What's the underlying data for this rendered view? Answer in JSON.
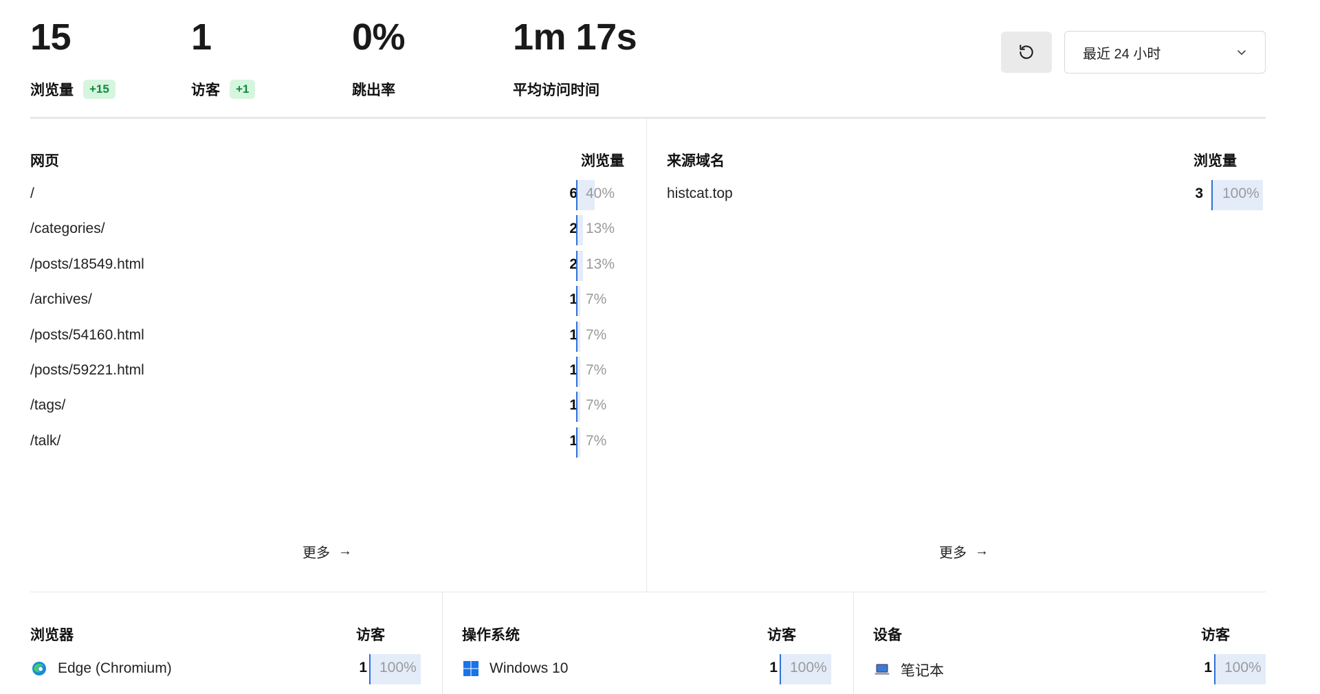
{
  "metrics": [
    {
      "value": "15",
      "label": "浏览量",
      "badge": "+15"
    },
    {
      "value": "1",
      "label": "访客",
      "badge": "+1"
    },
    {
      "value": "0%",
      "label": "跳出率",
      "badge": ""
    },
    {
      "value": "1m 17s",
      "label": "平均访问时间",
      "badge": ""
    }
  ],
  "controls": {
    "date_range": "最近 24 小时",
    "refresh_icon": "refresh-icon",
    "dropdown_icon": "chevron-down-icon"
  },
  "pages": {
    "title": "网页",
    "metric": "浏览量",
    "rows": [
      {
        "label": "/",
        "count": "6",
        "pct": "40%",
        "fraction": 0.4
      },
      {
        "label": "/categories/",
        "count": "2",
        "pct": "13%",
        "fraction": 0.13
      },
      {
        "label": "/posts/18549.html",
        "count": "2",
        "pct": "13%",
        "fraction": 0.13
      },
      {
        "label": "/archives/",
        "count": "1",
        "pct": "7%",
        "fraction": 0.07
      },
      {
        "label": "/posts/54160.html",
        "count": "1",
        "pct": "7%",
        "fraction": 0.07
      },
      {
        "label": "/posts/59221.html",
        "count": "1",
        "pct": "7%",
        "fraction": 0.07
      },
      {
        "label": "/tags/",
        "count": "1",
        "pct": "7%",
        "fraction": 0.07
      },
      {
        "label": "/talk/",
        "count": "1",
        "pct": "7%",
        "fraction": 0.07
      }
    ],
    "more": "更多"
  },
  "referrers": {
    "title": "来源域名",
    "metric": "浏览量",
    "rows": [
      {
        "label": "histcat.top",
        "count": "3",
        "pct": "100%",
        "fraction": 1.0
      }
    ],
    "more": "更多"
  },
  "browsers": {
    "title": "浏览器",
    "metric": "访客",
    "rows": [
      {
        "label": "Edge (Chromium)",
        "icon": "edge-icon",
        "count": "1",
        "pct": "100%",
        "fraction": 1.0
      }
    ]
  },
  "os": {
    "title": "操作系统",
    "metric": "访客",
    "rows": [
      {
        "label": "Windows 10",
        "icon": "windows-icon",
        "count": "1",
        "pct": "100%",
        "fraction": 1.0
      }
    ]
  },
  "devices": {
    "title": "设备",
    "metric": "访客",
    "rows": [
      {
        "label": "笔记本",
        "icon": "laptop-icon",
        "count": "1",
        "pct": "100%",
        "fraction": 1.0
      }
    ]
  },
  "colors": {
    "badge_bg": "#d6f5de",
    "badge_text": "#0b8a3c",
    "bar_fill": "#e4ecfa",
    "bar_edge": "#2f6fd6"
  }
}
